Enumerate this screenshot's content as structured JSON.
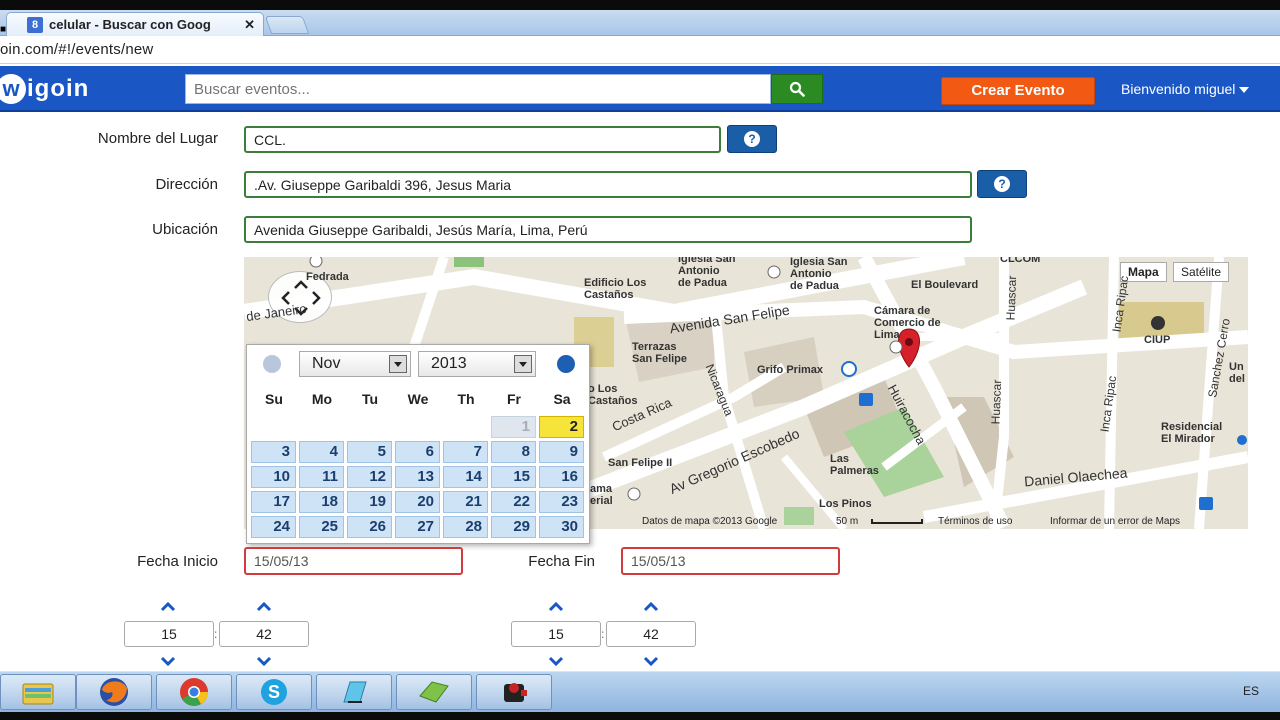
{
  "browser": {
    "tab_title": "celular - Buscar con Goog",
    "tab_close": "✕",
    "favicon": "8",
    "url": "oin.com/#!/events/new"
  },
  "header": {
    "logo_letter": "w",
    "logo_text": "igoin",
    "search_placeholder": "Buscar eventos...",
    "create_button": "Crear Evento",
    "welcome": "Bienvenido miguel"
  },
  "form": {
    "place_label": "Nombre del Lugar",
    "place_value": "CCL.",
    "address_label": "Dirección",
    "address_value": ".Av. Giuseppe Garibaldi 396, Jesus Maria",
    "location_label": "Ubicación",
    "location_value": "Avenida Giuseppe Garibaldi, Jesús María, Lima, Perú",
    "start_label": "Fecha Inicio",
    "start_value": "15/05/13",
    "end_label": "Fecha Fin",
    "end_value": "15/05/13",
    "start_hour": "15",
    "start_minute": "42",
    "end_hour": "15",
    "end_minute": "42",
    "time_separator": ":"
  },
  "map": {
    "type_map": "Mapa",
    "type_satellite": "Satélite",
    "footer_data": "Datos de mapa ©2013 Google",
    "footer_scale": "50 m",
    "footer_terms": "Términos de uso",
    "footer_report": "Informar de un error de Maps",
    "streets": {
      "san_felipe": "Avenida San Felipe",
      "olaechea": "Daniel Olaechea",
      "escobedo": "Av Gregorio Escobedo",
      "costa_rica": "Costa Rica",
      "nicaragua": "Nicaragua",
      "huiracocha": "Huiracocha",
      "huascar": "Huascar",
      "huascar2": "Huascar",
      "inca_ripac": "Inca Ripac",
      "inca_ripac2": "Inca Ripac",
      "sanchez_cerro": "Sanchez Cerro",
      "janeiro": "de Janeiro"
    },
    "places": {
      "iglesia1": "Iglesia San\nAntonio\nde Padua",
      "iglesia2": "Iglesia San\nAntonio\nde Padua",
      "edificio": "Edificio Los\nCastaños",
      "el_boulevard": "El Boulevard",
      "camara": "Cámara de\nComercio de\nLima",
      "ciup": "CIUP",
      "terrazas": "Terrazas\nSan Felipe",
      "grifo": "Grifo Primax",
      "residencial": "Residencial\nEl Mirador",
      "palmeras": "Las\nPalmeras",
      "san_felipe_ii": "San Felipe II",
      "los_pinos": "Los Pinos",
      "los": "o Los\nCastaños",
      "fedrada": "Fedrada",
      "clcom": "CLCOM",
      "un_del": "Un\ndel",
      "ama": "ama\nerial"
    }
  },
  "datepicker": {
    "month": "Nov",
    "year": "2013",
    "weekdays": [
      "Su",
      "Mo",
      "Tu",
      "We",
      "Th",
      "Fr",
      "Sa"
    ],
    "weeks": [
      [
        "",
        "",
        "",
        "",
        "",
        "1",
        "2"
      ],
      [
        "3",
        "4",
        "5",
        "6",
        "7",
        "8",
        "9"
      ],
      [
        "10",
        "11",
        "12",
        "13",
        "14",
        "15",
        "16"
      ],
      [
        "17",
        "18",
        "19",
        "20",
        "21",
        "22",
        "23"
      ],
      [
        "24",
        "25",
        "26",
        "27",
        "28",
        "29",
        "30"
      ]
    ],
    "other_month_days": [
      "1"
    ],
    "today": "2"
  },
  "taskbar": {
    "items": [
      "file-explorer-icon",
      "firefox-icon",
      "chrome-icon",
      "skype-icon",
      "notepad-icon",
      "green-app-icon",
      "camera-app-icon"
    ],
    "language": "ES"
  },
  "colors": {
    "header_blue": "#1a57c5",
    "create_orange": "#f25a14",
    "search_green": "#2b8a22",
    "input_green": "#3c7d3c",
    "date_red": "#d23b3b",
    "calendar_today": "#f7e43a"
  }
}
